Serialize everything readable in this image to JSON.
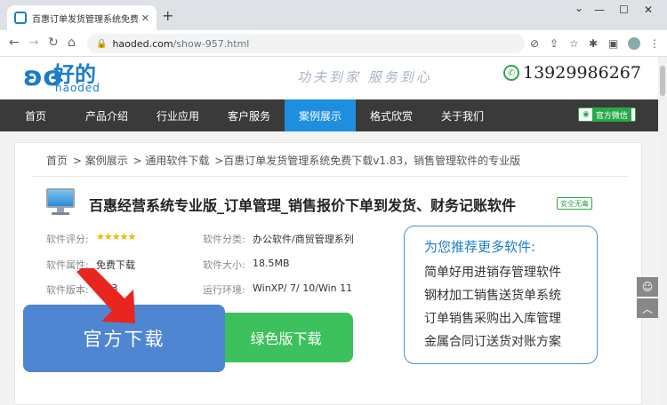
{
  "browser": {
    "tab_title": "百惠订单发货管理系统免费下载",
    "tab_close": "✕",
    "new_tab": "+",
    "url_host": "haoded.com",
    "url_path": "/show-957.html",
    "win_min": "—",
    "win_max": "☐",
    "win_close": "✕"
  },
  "site": {
    "logo_cn": "好的",
    "logo_en": "haoded",
    "slogan": "功夫到家  服务到心",
    "phone": "13929986267"
  },
  "nav": {
    "items": [
      "首页",
      "产品介绍",
      "行业应用",
      "客户服务",
      "案例展示",
      "格式欣赏",
      "关于我们"
    ],
    "active_index": 4,
    "wechat_label": "官方微信"
  },
  "breadcrumb": {
    "home": "首页",
    "l1": "> 案例展示",
    "l2": "> 通用软件下载",
    "l3": ">百惠订单发货管理系统免费下载v1.83，销售管理软件的专业版"
  },
  "software": {
    "title": "百惠经营系统专业版_订单管理_销售报价下单到发货、财务记账软件",
    "safe_badge": "安全无毒",
    "rating_label": "软件评分:",
    "rating_stars": "★★★★★",
    "rating_value": 5,
    "attr_label": "软件属性:",
    "attr_value": "免费下载",
    "version_label": "软件版本:",
    "version_value": "1.83",
    "category_label": "软件分类:",
    "category_value": "办公软件/商贸管理系列",
    "size_label": "软件大小:",
    "size_value": "18.5MB",
    "env_label": "运行环境:",
    "env_value": "WinXP/ 7/ 10/Win 11"
  },
  "buttons": {
    "official": "官方下载",
    "green": "绿色版下载"
  },
  "recommend": {
    "heading": "为您推荐更多软件:",
    "items": [
      "简单好用进销存管理软件",
      "钢材加工销售送货单系统",
      "订单销售采购出入库管理",
      "金属合同订送货对账方案"
    ]
  },
  "colors": {
    "brand": "#1c7cc8",
    "nav_bg": "#3a3a3a",
    "nav_active": "#1e8fde",
    "official_btn": "#4f86d1",
    "green_btn": "#3cc15c",
    "arrow": "#e8261f"
  },
  "icons": {
    "logo": "hao-logo-icon",
    "phone": "phone-icon",
    "wechat": "wechat-icon",
    "software": "monitor-icon",
    "arrow": "red-arrow-icon"
  }
}
